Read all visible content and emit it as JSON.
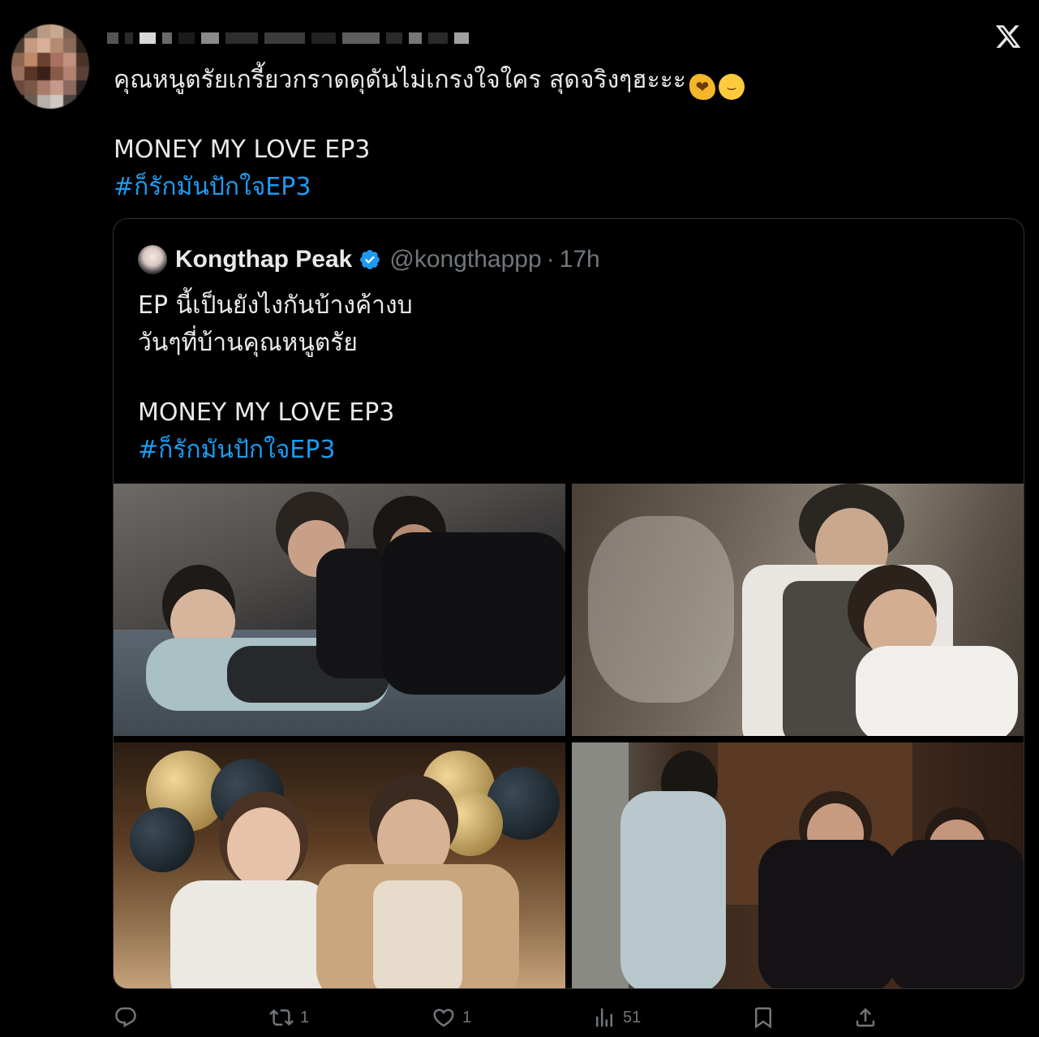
{
  "tweet": {
    "text_line_1": "คุณหนูตรัยเกรี้ยวกราดดุดันไม่เกรงใจใคร สุดจริงๆฮะะะ",
    "emoji_1": "flexed-biceps",
    "emoji_2": "grinning-squinting-face",
    "text_line_2": "MONEY MY LOVE EP3",
    "hashtag": "#ก็รักมันปักใจEP3"
  },
  "quote": {
    "name": "Kongthap Peak",
    "handle": "@kongthappp",
    "separator": "·",
    "time": "17h",
    "text_line_1": "EP นี้เป็นยังไงกันบ้างค้างบ",
    "text_line_2": "วันๆที่บ้านคุณหนูตรัย",
    "text_line_3": "MONEY MY LOVE EP3",
    "hashtag": "#ก็รักมันปักใจEP3",
    "media": [
      {
        "label": "bedroom-scene-photo"
      },
      {
        "label": "embrace-scene-photo"
      },
      {
        "label": "party-scene-photo"
      },
      {
        "label": "pleading-scene-photo"
      }
    ]
  },
  "actions": {
    "reply_count": "",
    "retweet_count": "1",
    "like_count": "1",
    "views_count": "51"
  },
  "colors": {
    "background": "#000000",
    "text": "#e7e9ea",
    "muted": "#71767b",
    "link": "#1d9bf0",
    "border": "#2f3336",
    "verified": "#1d9bf0"
  },
  "icons": [
    "x-logo-icon",
    "verified-badge-icon",
    "reply-icon",
    "retweet-icon",
    "like-icon",
    "views-icon",
    "bookmark-icon",
    "share-icon"
  ]
}
